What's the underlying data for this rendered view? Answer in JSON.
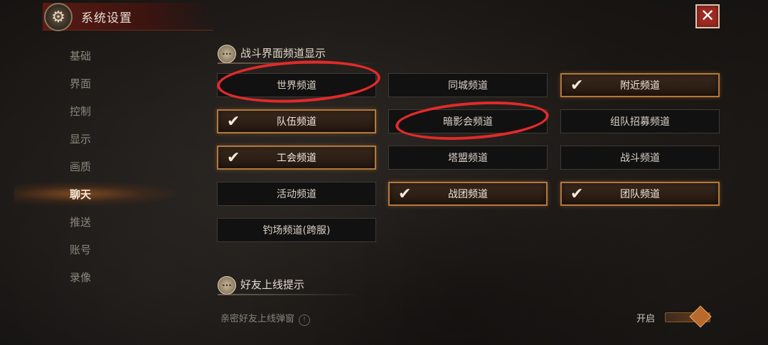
{
  "header": {
    "title": "系统设置",
    "settings_icon": "gear-icon",
    "close_icon": "close-icon",
    "close_label": "✕"
  },
  "sidebar": {
    "items": [
      {
        "label": "基础"
      },
      {
        "label": "界面"
      },
      {
        "label": "控制"
      },
      {
        "label": "显示"
      },
      {
        "label": "画质"
      },
      {
        "label": "聊天",
        "active": true
      },
      {
        "label": "推送"
      },
      {
        "label": "账号"
      },
      {
        "label": "录像"
      }
    ]
  },
  "section_battle": {
    "title": "战斗界面频道显示",
    "icon": "chat-bubble-icon",
    "channels": [
      {
        "label": "世界频道",
        "checked": false
      },
      {
        "label": "同城频道",
        "checked": false
      },
      {
        "label": "附近频道",
        "checked": true
      },
      {
        "label": "队伍频道",
        "checked": true
      },
      {
        "label": "暗影会频道",
        "checked": false
      },
      {
        "label": "组队招募频道",
        "checked": false
      },
      {
        "label": "工会频道",
        "checked": true
      },
      {
        "label": "塔盟频道",
        "checked": false
      },
      {
        "label": "战斗频道",
        "checked": false
      },
      {
        "label": "活动频道",
        "checked": false
      },
      {
        "label": "战团频道",
        "checked": true
      },
      {
        "label": "团队频道",
        "checked": true
      },
      {
        "label": "钓场频道(跨服)",
        "checked": false
      }
    ]
  },
  "section_friends": {
    "title": "好友上线提示",
    "icon": "chat-bubble-icon",
    "row_label": "亲密好友上线弹窗",
    "toggle_label": "开启",
    "toggle_on": true
  },
  "check_glyph": "✔",
  "info_glyph": "!",
  "colors": {
    "accent": "#b27a3e",
    "annotation_red": "#e22a2a",
    "close_bg": "#9d2b22"
  }
}
